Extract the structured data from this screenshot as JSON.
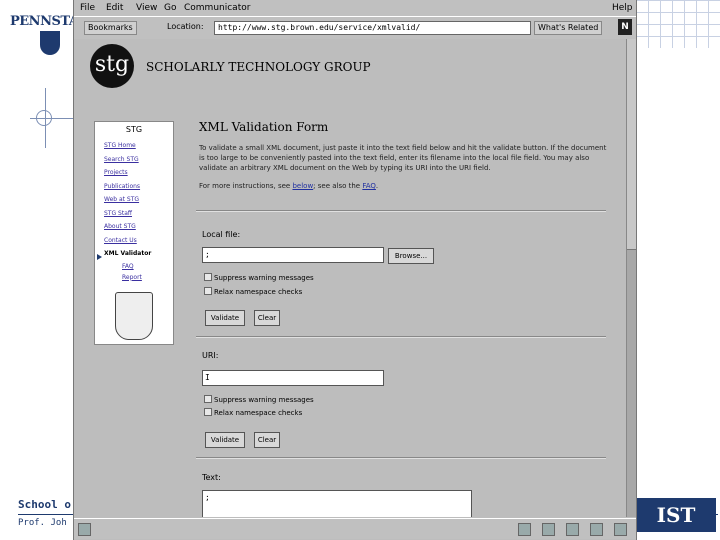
{
  "slide": {
    "psu_logo_text": "PENNSTATE",
    "footer_school": "School o",
    "footer_prof": "Prof. Joh",
    "ist_logo_text": "IST",
    "colors": {
      "navy": "#1e3a6e",
      "window_gray": "#bdbdbd",
      "link": "#3a2fa0"
    }
  },
  "browser": {
    "menu": [
      "File",
      "Edit",
      "View",
      "Go",
      "Communicator",
      "Help"
    ],
    "toolbar": {
      "bookmarks_label": "Bookmarks",
      "location_label": "Location:",
      "url": "http://www.stg.brown.edu/service/xmlvalid/",
      "whats_related_label": "What's Related",
      "netscape_icon": "N"
    }
  },
  "page": {
    "logo_text": "stg",
    "org_title": "SCHOLARLY TECHNOLOGY GROUP",
    "sidebar": {
      "header": "STG",
      "links": [
        {
          "label": "STG Home",
          "active": false
        },
        {
          "label": "Search STG",
          "active": false
        },
        {
          "label": "Projects",
          "active": false
        },
        {
          "label": "Publications",
          "active": false
        },
        {
          "label": "Web at STG",
          "active": false
        },
        {
          "label": "STG Staff",
          "active": false
        },
        {
          "label": "About STG",
          "active": false
        },
        {
          "label": "Contact Us",
          "active": false
        },
        {
          "label": "XML Validator",
          "active": true
        }
      ],
      "sublinks": [
        "FAQ",
        "Report"
      ]
    },
    "form_title": "XML Validation Form",
    "intro_text": "To validate a small XML document, just paste it into the text field below and hit the validate button. If the document is too large to be conveniently pasted into the text field, enter its filename into the local file field. You may also validate an arbitrary XML document on the Web by typing its URI into the URI field.",
    "more_info": {
      "prefix": "For more instructions, see",
      "link1": "below",
      "middle": "; see also the",
      "link2": "FAQ",
      "suffix": "."
    },
    "local_file": {
      "label": "Local file:",
      "value": ";",
      "browse_label": "Browse...",
      "opt1": "Suppress warning messages",
      "opt2": "Relax namespace checks",
      "validate_label": "Validate",
      "clear_label": "Clear"
    },
    "uri": {
      "label": "URI:",
      "value": "I",
      "opt1": "Suppress warning messages",
      "opt2": "Relax namespace checks",
      "validate_label": "Validate",
      "clear_label": "Clear"
    },
    "text": {
      "label": "Text:",
      "value": ";"
    }
  }
}
